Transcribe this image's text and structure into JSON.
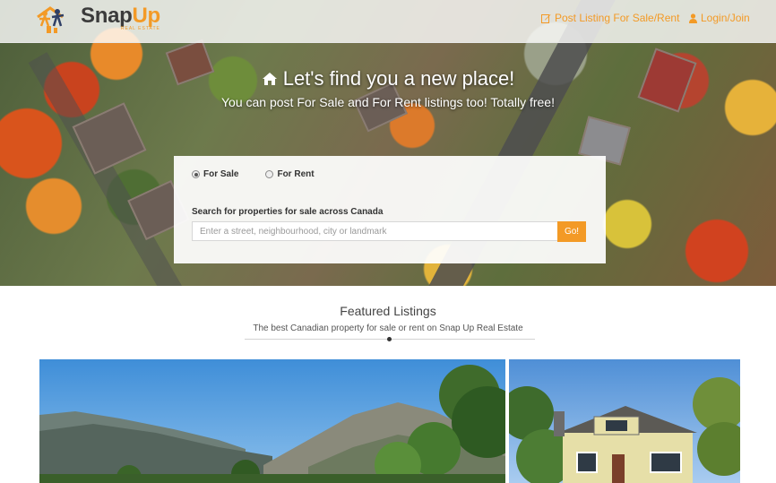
{
  "brand": {
    "name_part1": "Snap",
    "name_part2": "Up",
    "tagline": "REAL ESTATE",
    "accent": "#f39a26"
  },
  "nav": {
    "post_label": "Post Listing For Sale/Rent",
    "login_label": "Login/Join"
  },
  "hero": {
    "title": "Let's find you a new place!",
    "subtitle": "You can post For Sale and For Rent listings too! Totally free!"
  },
  "search": {
    "options": [
      "For Sale",
      "For Rent"
    ],
    "selected": "For Sale",
    "label": "Search for properties for sale across Canada",
    "placeholder": "Enter a street, neighbourhood, city or landmark",
    "button": "Go!"
  },
  "featured": {
    "title": "Featured Listings",
    "subtitle": "The best Canadian property for sale or rent on Snap Up Real Estate"
  },
  "icons": {
    "logo": "people-house-logo-icon",
    "post": "edit-icon",
    "login": "user-icon",
    "home": "home-icon"
  }
}
